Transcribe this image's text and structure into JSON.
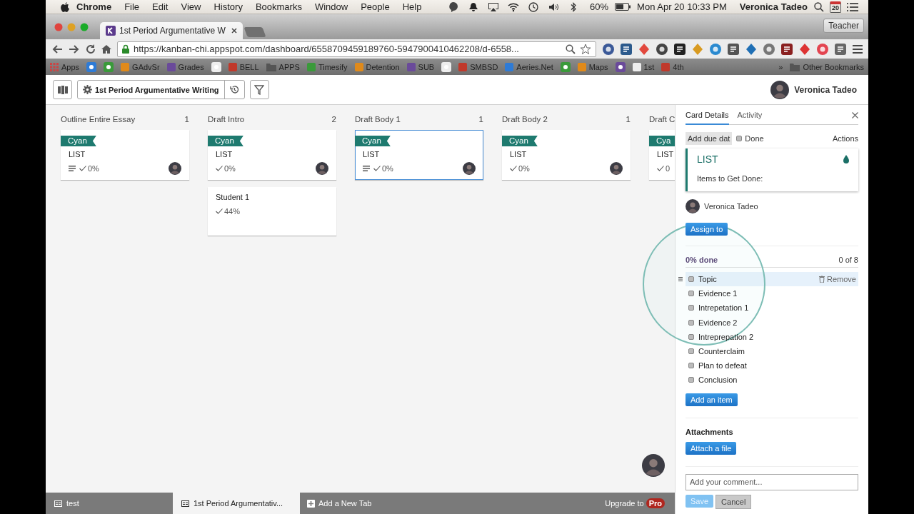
{
  "menubar": {
    "app": "Chrome",
    "menus": [
      "File",
      "Edit",
      "View",
      "History",
      "Bookmarks",
      "Window",
      "People",
      "Help"
    ],
    "battery": "60%",
    "clock": "Mon Apr 20  10:33 PM",
    "user": "Veronica Tadeo",
    "calendar_day": "20"
  },
  "browser": {
    "tab_title": "1st Period Argumentative W",
    "profile": "Teacher",
    "url": "https://kanban-chi.appspot.com/dashboard/6558709459189760-5947900410462208/d-6558...",
    "bookmarks": [
      {
        "kind": "apps",
        "label": "Apps"
      },
      {
        "kind": "icon"
      },
      {
        "kind": "icon"
      },
      {
        "kind": "page",
        "label": "GAdvSr"
      },
      {
        "kind": "page",
        "label": "Grades"
      },
      {
        "kind": "icon"
      },
      {
        "kind": "page",
        "label": "BELL"
      },
      {
        "kind": "folder",
        "label": "APPS"
      },
      {
        "kind": "page",
        "label": "Timesify"
      },
      {
        "kind": "page",
        "label": "Detention"
      },
      {
        "kind": "page",
        "label": "SUB"
      },
      {
        "kind": "icon"
      },
      {
        "kind": "page",
        "label": "SMBSD"
      },
      {
        "kind": "page",
        "label": "Aeries.Net"
      },
      {
        "kind": "icon"
      },
      {
        "kind": "page",
        "label": "Maps"
      },
      {
        "kind": "icon"
      },
      {
        "kind": "page",
        "label": "1st"
      },
      {
        "kind": "page",
        "label": "4th"
      }
    ],
    "overflow": "»",
    "other": "Other Bookmarks"
  },
  "header": {
    "board_title": "1st Period Argumentative Writing",
    "user": "Veronica Tadeo"
  },
  "lists": [
    {
      "title": "Outline Entire Essay",
      "count": "1",
      "cards": [
        {
          "tag": "Cyan",
          "title": "LIST",
          "has_description": true,
          "progress": "0%",
          "assigned": true,
          "selected": false
        }
      ]
    },
    {
      "title": "Draft Intro",
      "count": "2",
      "cards": [
        {
          "tag": "Cyan",
          "title": "LIST",
          "has_description": false,
          "progress": "0%",
          "assigned": true,
          "selected": false
        },
        {
          "title": "Student 1",
          "has_description": false,
          "progress": "44%",
          "assigned": false,
          "selected": false
        }
      ]
    },
    {
      "title": "Draft Body 1",
      "count": "1",
      "cards": [
        {
          "tag": "Cyan",
          "title": "LIST",
          "has_description": true,
          "progress": "0%",
          "assigned": true,
          "selected": true
        }
      ]
    },
    {
      "title": "Draft Body 2",
      "count": "1",
      "cards": [
        {
          "tag": "Cyan",
          "title": "LIST",
          "has_description": false,
          "progress": "0%",
          "assigned": true,
          "selected": false
        }
      ]
    },
    {
      "title": "Draft C",
      "cards": [
        {
          "tag": "Cya",
          "title": "LIST",
          "has_description": false,
          "progress": "0",
          "assigned": false,
          "selected": false
        }
      ]
    }
  ],
  "panel": {
    "tabs": [
      {
        "label": "Card Details",
        "selected": true
      },
      {
        "label": "Activity",
        "selected": false
      }
    ],
    "due_date": "Add due dat",
    "done": {
      "label": "Done",
      "checked": false
    },
    "actions": "Actions",
    "card": {
      "title": "LIST",
      "description": "Items to Get Done:"
    },
    "assignee": "Veronica Tadeo",
    "assign_button": "Assign to",
    "checklist": {
      "summary": "0% done",
      "count": "0 of 8",
      "remove": "Remove",
      "add_button": "Add an item",
      "items": [
        {
          "label": "Topic",
          "checked": false,
          "hovered": true
        },
        {
          "label": "Evidence 1",
          "checked": false,
          "hovered": false
        },
        {
          "label": "Intrepetation 1",
          "checked": false,
          "hovered": false
        },
        {
          "label": "Evidence 2",
          "checked": false,
          "hovered": false
        },
        {
          "label": "Intreprepation 2",
          "checked": false,
          "hovered": false
        },
        {
          "label": "Counterclaim",
          "checked": false,
          "hovered": false
        },
        {
          "label": "Plan to defeat",
          "checked": false,
          "hovered": false
        },
        {
          "label": "Conclusion",
          "checked": false,
          "hovered": false
        }
      ]
    },
    "attachments": {
      "title": "Attachments",
      "button": "Attach a file"
    },
    "comment": {
      "placeholder": "Add your comment...",
      "save": "Save",
      "save_disabled": true,
      "cancel": "Cancel"
    }
  },
  "bottom_bar": {
    "tabs": [
      {
        "label": "test",
        "selected": false
      },
      {
        "label": "1st Period Argumentativ...",
        "selected": true
      }
    ],
    "add_tab": "Add a New Tab",
    "upgrade": "Upgrade to",
    "pro": "Pro"
  }
}
